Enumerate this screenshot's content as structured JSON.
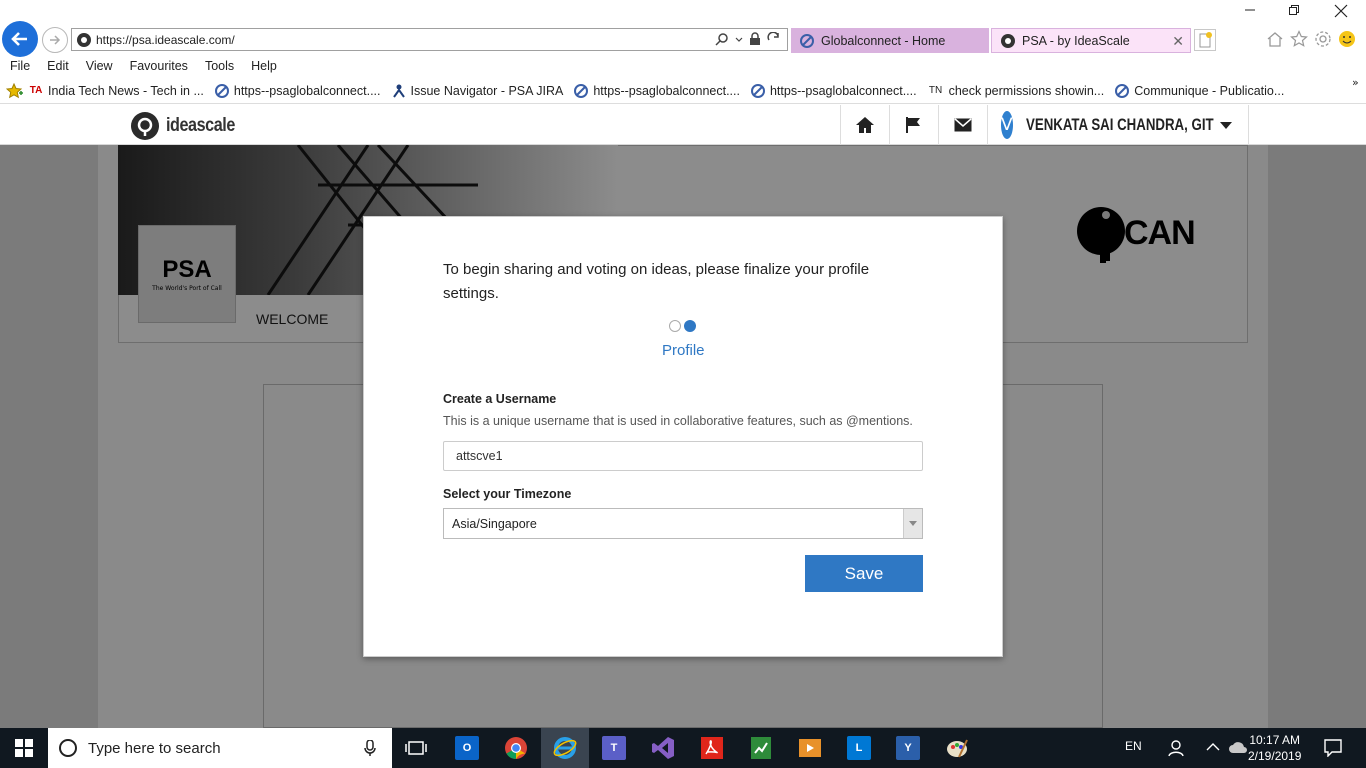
{
  "browser": {
    "url": "https://psa.ideascale.com/",
    "tabs": [
      {
        "title": "Globalconnect - Home",
        "icon": "ideascale-tab-icon"
      },
      {
        "title": "PSA - by IdeaScale",
        "icon": "ideascale-tab-icon",
        "active": true
      }
    ],
    "close_tab_glyph": "✕",
    "menu": [
      "File",
      "Edit",
      "View",
      "Favourites",
      "Tools",
      "Help"
    ],
    "favourites": [
      {
        "label": "India Tech News - Tech in ...",
        "icon": "ta-icon"
      },
      {
        "label": "https--psaglobalconnect....",
        "icon": "globe-icon"
      },
      {
        "label": "Issue Navigator - PSA JIRA",
        "icon": "jira-icon"
      },
      {
        "label": "https--psaglobalconnect....",
        "icon": "globe-icon"
      },
      {
        "label": "https--psaglobalconnect....",
        "icon": "globe-icon"
      },
      {
        "label": "check permissions showin...",
        "icon": "tn-icon",
        "prefix": "TN"
      },
      {
        "label": "Communique - Publicatio...",
        "icon": "globe-icon"
      }
    ],
    "favourites_more": "»"
  },
  "site_header": {
    "logo_text": "ideascale",
    "user_initial": "V",
    "user_name": "VENKATA SAI CHANDRA, GIT"
  },
  "page": {
    "org_logo_text": "PSA",
    "org_logo_tagline": "The World's Port of Call",
    "welcome": "WELCOME",
    "program_logo_text": "CAN"
  },
  "modal": {
    "intro": "To begin sharing and voting on ideas, please finalize your profile settings.",
    "step_label": "Profile",
    "steps_total": 2,
    "step_current": 2,
    "username_label": "Create a Username",
    "username_help": "This is a unique username that is used in collaborative features, such as @mentions.",
    "username_value": "attscve1",
    "timezone_label": "Select your Timezone",
    "timezone_value": "Asia/Singapore",
    "save_label": "Save",
    "accent_color": "#2f78c4"
  },
  "taskbar": {
    "search_placeholder": "Type here to search",
    "language": "EN",
    "time": "10:17 AM",
    "date": "2/19/2019",
    "apps": [
      "task-view",
      "outlook",
      "chrome",
      "internet-explorer",
      "teams",
      "visual-studio",
      "acrobat",
      "excel-tool",
      "media-player",
      "lync",
      "yammer",
      "paint"
    ]
  }
}
